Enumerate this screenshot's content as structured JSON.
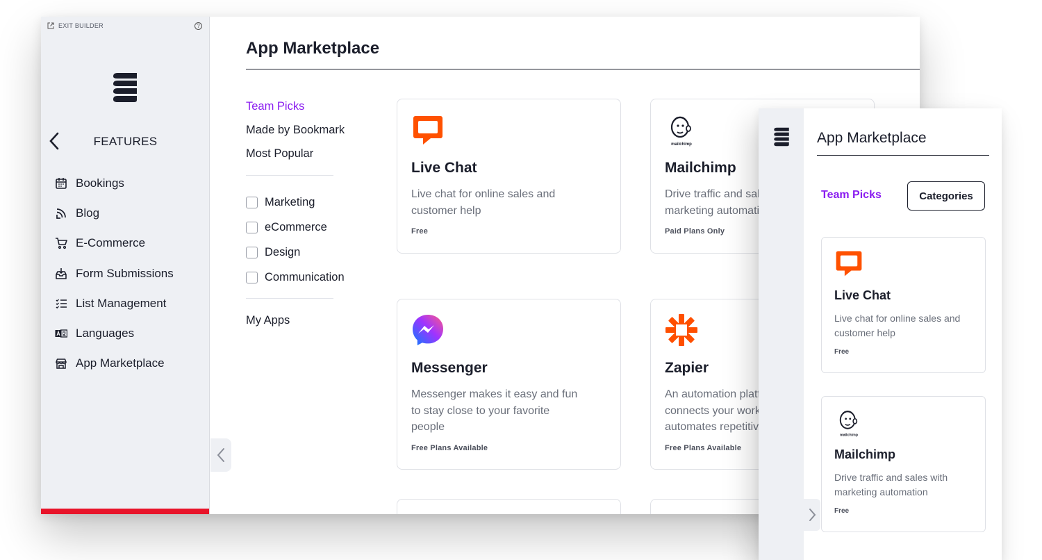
{
  "sidebar": {
    "exit_label": "EXIT BUILDER",
    "help_label": "?",
    "section_title": "FEATURES",
    "items": [
      {
        "label": "Bookings",
        "icon": "calendar-icon"
      },
      {
        "label": "Blog",
        "icon": "rss-icon"
      },
      {
        "label": "E-Commerce",
        "icon": "cart-icon"
      },
      {
        "label": "Form Submissions",
        "icon": "inbox-icon"
      },
      {
        "label": "List Management",
        "icon": "list-icon"
      },
      {
        "label": "Languages",
        "icon": "translate-icon"
      },
      {
        "label": "App Marketplace",
        "icon": "store-icon"
      }
    ]
  },
  "main": {
    "title": "App Marketplace",
    "filters": {
      "links": [
        "Team Picks",
        "Made by Bookmark",
        "Most Popular"
      ],
      "categories": [
        "Marketing",
        "eCommerce",
        "Design",
        "Communication"
      ],
      "my_apps": "My Apps"
    },
    "cards": [
      {
        "name": "Live Chat",
        "desc": "Live chat for online sales and customer help",
        "price": "Free"
      },
      {
        "name": "Mailchimp",
        "desc": "Drive traffic and sales with marketing automation",
        "price": "Paid Plans Only"
      },
      {
        "name": "Messenger",
        "desc": "Messenger makes it easy and fun to stay close to your favorite people",
        "price": "Free Plans Available"
      },
      {
        "name": "Zapier",
        "desc": "An automation platform that connects your work apps & automates repetitive tasks for you",
        "price": "Free Plans Available"
      }
    ]
  },
  "mobile": {
    "title": "App Marketplace",
    "team_picks": "Team Picks",
    "categories_button": "Categories",
    "cards": [
      {
        "name": "Live Chat",
        "desc": "Live chat for online sales and customer help",
        "price": "Free"
      },
      {
        "name": "Mailchimp",
        "desc": "Drive traffic and sales with marketing automation",
        "price": "Free"
      }
    ]
  },
  "colors": {
    "accent": "#8a1cf0",
    "livechat": "#ff5100",
    "zapier": "#ff4f00",
    "redbar": "#e8142a"
  },
  "brand_marks": {
    "mailchimp_wordmark": "mailchimp"
  }
}
